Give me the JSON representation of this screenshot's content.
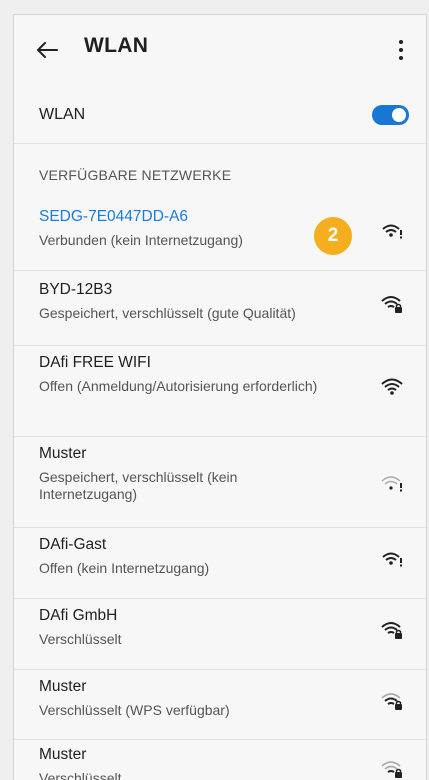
{
  "appbar": {
    "title": "WLAN"
  },
  "wlan_toggle": {
    "label": "WLAN",
    "state": "on",
    "accent": "#1976d2"
  },
  "section_header": "VERFÜGBARE NETZWERKE",
  "networks": [
    {
      "name": "SEDG-7E0447DD-A6",
      "status": "Verbunden (kein Internetzugang)",
      "active": true,
      "icon": "wifi-warning-icon"
    },
    {
      "name": "BYD-12B3",
      "status": "Gespeichert, verschlüsselt (gute Qualität)",
      "active": false,
      "icon": "wifi-lock-icon"
    },
    {
      "name": "DAfi FREE WIFI",
      "status": "Offen (Anmeldung/Autorisierung erforderlich)",
      "active": false,
      "icon": "wifi-icon"
    },
    {
      "name": "Muster",
      "status": "Gespeichert, verschlüsselt (kein Internetzugang)",
      "active": false,
      "icon": "wifi-weak-warning-icon"
    },
    {
      "name": "DAfi-Gast",
      "status": "Offen (kein Internetzugang)",
      "active": false,
      "icon": "wifi-warning-icon"
    },
    {
      "name": "DAfi GmbH",
      "status": "Verschlüsselt",
      "active": false,
      "icon": "wifi-lock-icon"
    },
    {
      "name": "Muster",
      "status": "Verschlüsselt (WPS verfügbar)",
      "active": false,
      "icon": "wifi-lock-icon"
    },
    {
      "name": "Muster",
      "status": "Verschlüsselt",
      "active": false,
      "icon": "wifi-lock-icon"
    }
  ],
  "callout_badge": {
    "number": "2",
    "color": "#f5ae1d"
  }
}
